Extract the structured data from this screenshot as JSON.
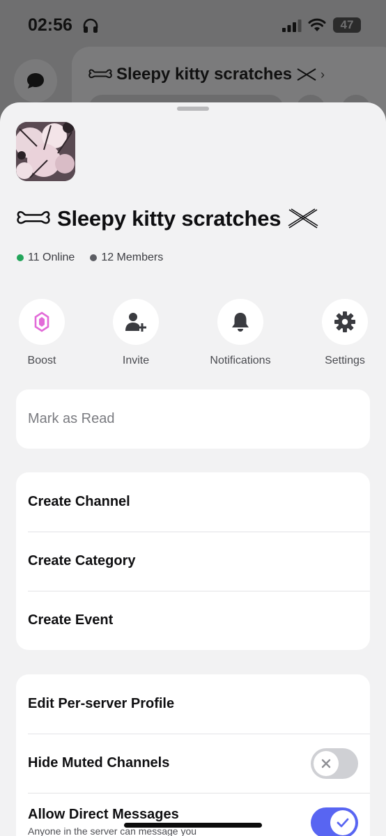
{
  "status_bar": {
    "time": "02:56",
    "battery": "47"
  },
  "server": {
    "name": "Sleepy kitty scratches",
    "online": "11 Online",
    "members": "12 Members",
    "online_color": "#23a55a",
    "members_color": "#5c5d63"
  },
  "actions": [
    {
      "label": "Boost",
      "icon": "boost-gem-icon"
    },
    {
      "label": "Invite",
      "icon": "add-person-icon"
    },
    {
      "label": "Notifications",
      "icon": "bell-icon"
    },
    {
      "label": "Settings",
      "icon": "gear-icon"
    }
  ],
  "menu": {
    "mark_read": "Mark as Read",
    "create_channel": "Create Channel",
    "create_category": "Create Category",
    "create_event": "Create Event",
    "edit_profile": "Edit Per-server Profile",
    "hide_muted": "Hide Muted Channels",
    "allow_dms": "Allow Direct Messages",
    "allow_dms_sub": "Anyone in the server can message you"
  },
  "toggles": {
    "hide_muted": false,
    "allow_dms": true
  },
  "colors": {
    "accent": "#5865f2",
    "boost": "#e26bd8"
  }
}
